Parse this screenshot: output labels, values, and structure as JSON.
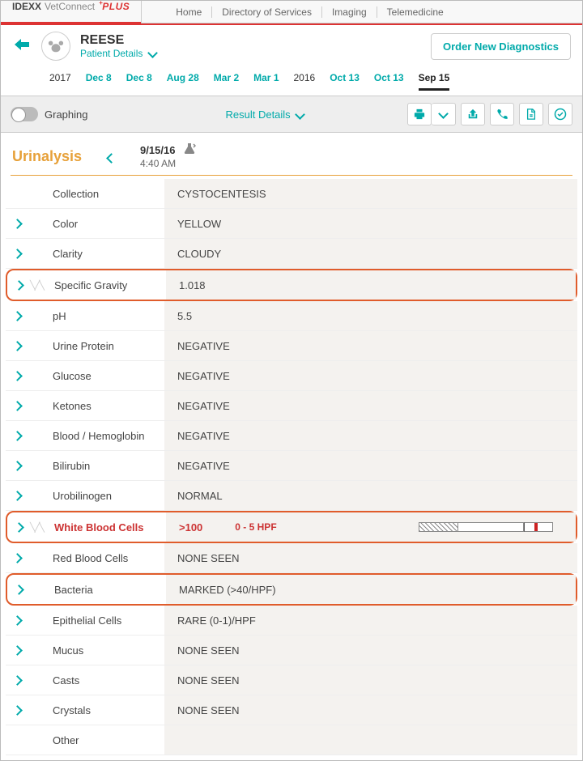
{
  "brand": {
    "a": "IDEXX",
    "b": "VetConnect",
    "c": "PLUS"
  },
  "topnav": [
    "Home",
    "Directory of Services",
    "Imaging",
    "Telemedicine"
  ],
  "patient": {
    "name": "REESE",
    "sub": "Patient Details",
    "order_btn": "Order New Diagnostics"
  },
  "dates": [
    {
      "text": "2017",
      "kind": "year"
    },
    {
      "text": "Dec 8",
      "kind": "link"
    },
    {
      "text": "Dec 8",
      "kind": "link"
    },
    {
      "text": "Aug 28",
      "kind": "link"
    },
    {
      "text": "Mar 2",
      "kind": "link"
    },
    {
      "text": "Mar 1",
      "kind": "link"
    },
    {
      "text": "2016",
      "kind": "year"
    },
    {
      "text": "Oct 13",
      "kind": "link"
    },
    {
      "text": "Oct 13",
      "kind": "link"
    },
    {
      "text": "Sep 15",
      "kind": "active"
    }
  ],
  "toolbar": {
    "graphing": "Graphing",
    "result_details": "Result Details"
  },
  "panel": {
    "title": "Urinalysis",
    "date": "9/15/16",
    "time": "4:40 AM"
  },
  "rows": [
    {
      "name": "Collection",
      "val": "CYSTOCENTESIS",
      "exp": false,
      "waves": false
    },
    {
      "name": "Color",
      "val": "YELLOW",
      "exp": true
    },
    {
      "name": "Clarity",
      "val": "CLOUDY",
      "exp": true
    },
    {
      "name": "Specific Gravity",
      "val": "1.018",
      "exp": true,
      "waves": true,
      "hl": true
    },
    {
      "name": "pH",
      "val": "5.5",
      "exp": true
    },
    {
      "name": "Urine Protein",
      "val": "NEGATIVE",
      "exp": true
    },
    {
      "name": "Glucose",
      "val": "NEGATIVE",
      "exp": true
    },
    {
      "name": "Ketones",
      "val": "NEGATIVE",
      "exp": true
    },
    {
      "name": "Blood / Hemoglobin",
      "val": "NEGATIVE",
      "exp": true
    },
    {
      "name": "Bilirubin",
      "val": "NEGATIVE",
      "exp": true
    },
    {
      "name": "Urobilinogen",
      "val": "NORMAL",
      "exp": true
    },
    {
      "name": "White Blood Cells",
      "val": ">100",
      "ref": "0 - 5 HPF",
      "exp": true,
      "waves": true,
      "hl": true,
      "abnormal": true,
      "bar": true
    },
    {
      "name": "Red Blood Cells",
      "val": "NONE SEEN",
      "exp": true
    },
    {
      "name": "Bacteria",
      "val": "MARKED (>40/HPF)",
      "exp": true,
      "hl": true
    },
    {
      "name": "Epithelial Cells",
      "val": "RARE (0-1)/HPF",
      "exp": true
    },
    {
      "name": "Mucus",
      "val": "NONE SEEN",
      "exp": true
    },
    {
      "name": "Casts",
      "val": "NONE SEEN",
      "exp": true
    },
    {
      "name": "Crystals",
      "val": "NONE SEEN",
      "exp": true
    },
    {
      "name": "Other",
      "val": "",
      "exp": false
    }
  ]
}
